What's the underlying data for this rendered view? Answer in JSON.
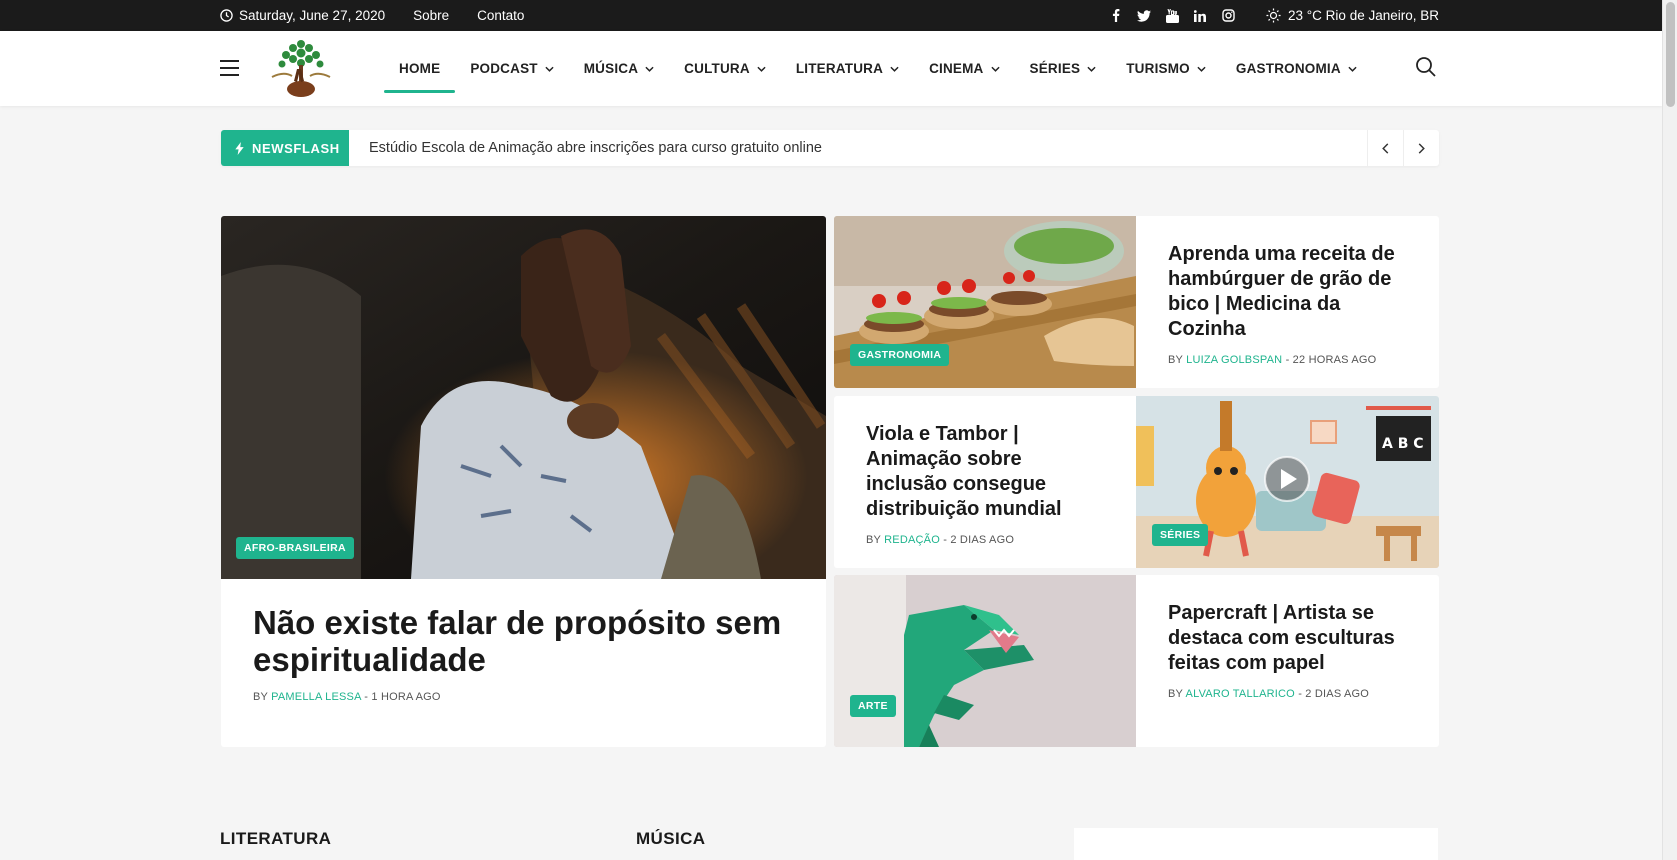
{
  "topbar": {
    "date": "Saturday, June 27, 2020",
    "links": [
      "Sobre",
      "Contato"
    ],
    "social_icons": [
      "facebook-icon",
      "twitter-icon",
      "youtube-icon",
      "linkedin-icon",
      "instagram-icon"
    ],
    "weather": "23 °C Rio de Janeiro, BR"
  },
  "nav": {
    "items": [
      {
        "label": "HOME",
        "dropdown": false,
        "active": true
      },
      {
        "label": "PODCAST",
        "dropdown": true
      },
      {
        "label": "MÚSICA",
        "dropdown": true
      },
      {
        "label": "CULTURA",
        "dropdown": true
      },
      {
        "label": "LITERATURA",
        "dropdown": true
      },
      {
        "label": "CINEMA",
        "dropdown": true
      },
      {
        "label": "SÉRIES",
        "dropdown": true
      },
      {
        "label": "TURISMO",
        "dropdown": true
      },
      {
        "label": "GASTRONOMIA",
        "dropdown": true
      }
    ]
  },
  "newsflash": {
    "label": "NEWSFLASH",
    "text": "Estúdio Escola de Animação abre inscrições para curso gratuito online"
  },
  "featured": {
    "badge": "AFRO-BRASILEIRA",
    "title": "Não existe falar de propósito sem espiritualidade",
    "by": "BY",
    "author": "PAMELLA LESSA",
    "time": "- 1 HORA AGO"
  },
  "cards": [
    {
      "badge": "GASTRONOMIA",
      "title": "Aprenda uma receita de hambúrguer de grão de bico | Medicina da Cozinha",
      "by": "BY",
      "author": "LUIZA GOLBSPAN",
      "time": "- 22 HORAS AGO"
    },
    {
      "badge": "SÉRIES",
      "title": "Viola e Tambor | Animação sobre inclusão consegue distribuição mundial",
      "by": "BY",
      "author": "REDAÇÃO",
      "time": "- 2 DIAS AGO"
    },
    {
      "badge": "ARTE",
      "title": "Papercraft | Artista se destaca com esculturas feitas com papel",
      "by": "BY",
      "author": "ALVARO TALLARICO",
      "time": "- 2 DIAS AGO"
    }
  ],
  "sections": [
    "LITERATURA",
    "MÚSICA"
  ],
  "colors": {
    "accent": "#1fb48e",
    "topbar": "#1b1b1b"
  }
}
